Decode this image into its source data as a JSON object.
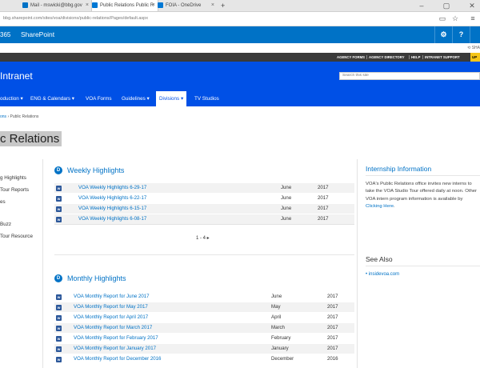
{
  "browser": {
    "tabs": [
      {
        "label": "Mail - mswicki@bbg.gov",
        "icon": "outlook-icon",
        "color": "#0072c6"
      },
      {
        "label": "Public Relations Public R",
        "icon": "sharepoint-icon",
        "color": "#0078d4",
        "active": true
      },
      {
        "label": "FOIA - OneDrive",
        "icon": "onedrive-icon",
        "color": "#0078d4"
      }
    ],
    "new_tab": "+",
    "close": "×",
    "url": "bbg.sharepoint.com/sites/voa/divisions/public-relations/Pages/default.aspx",
    "star": "☆",
    "menu": "≡"
  },
  "suite": {
    "brand": "365",
    "app": "SharePoint",
    "settings_icon": "⚙",
    "help_icon": "?",
    "share_label": "SHA"
  },
  "top_links": [
    "AGENCY FORMS",
    "AGENCY DIRECTORY",
    "HELP",
    "INTRANET SUPPORT"
  ],
  "top_button": "UP",
  "header": {
    "site_title": "Intranet",
    "search_placeholder": "Search this site"
  },
  "nav": [
    {
      "label": "oduction ▾"
    },
    {
      "label": "ENG & Calendars ▾"
    },
    {
      "label": "VOA Forms"
    },
    {
      "label": "Guidelines ▾"
    },
    {
      "label": "Divisions ▾",
      "selected": true
    },
    {
      "label": "TV Studios"
    }
  ],
  "breadcrumb": {
    "parent": "ons",
    "sep": "›",
    "current": "Public Relations"
  },
  "page_title": "c Relations",
  "quicklaunch": [
    "g Highlights",
    "Tour Reports",
    "es",
    "Buzz",
    "Tour Resource"
  ],
  "weekly": {
    "title": "Weekly Highlights",
    "rows": [
      {
        "title": "VOA Weekly Highlights 6-29-17",
        "month": "June",
        "year": "2017"
      },
      {
        "title": "VOA Weekly Highlights 6-22-17",
        "month": "June",
        "year": "2017"
      },
      {
        "title": "VOA Weekly Highlights 6-15-17",
        "month": "June",
        "year": "2017"
      },
      {
        "title": "VOA Weekly Highlights 6-08-17",
        "month": "June",
        "year": "2017"
      }
    ],
    "pager": "1 - 4 ▸"
  },
  "monthly": {
    "title": "Monthly Highlights",
    "rows": [
      {
        "title": "VOA Monthly Report for June 2017",
        "month": "June",
        "year": "2017"
      },
      {
        "title": "VOA Monthly Report for May 2017",
        "month": "May",
        "year": "2017"
      },
      {
        "title": "VOA Monthly Report for April 2017",
        "month": "April",
        "year": "2017"
      },
      {
        "title": "VOA Monthly Report for March 2017",
        "month": "March",
        "year": "2017"
      },
      {
        "title": "VOA Monthly Report for February 2017",
        "month": "February",
        "year": "2017"
      },
      {
        "title": "VOA Monthly Report for January 2017",
        "month": "January",
        "year": "2017"
      },
      {
        "title": "VOA Monthly Report for December 2016",
        "month": "December",
        "year": "2016"
      }
    ]
  },
  "internship": {
    "title": "Internship Information",
    "text_a": "VOA's Public Relations office invites new interns to take the VOA Studio Tour offered daily at noon. Other VOA intern program information is available by ",
    "link": "Clicking Here",
    "text_b": "."
  },
  "see_also": {
    "title": "See Also",
    "items": [
      "insidevoa.com"
    ]
  },
  "colors": {
    "suite": "#0072c6",
    "header": "#0050e6",
    "toplinks": "#3a3a3a",
    "link": "#0072c6"
  }
}
